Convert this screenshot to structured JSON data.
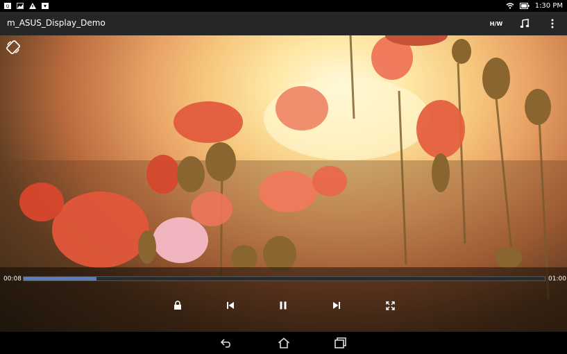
{
  "status_bar": {
    "time": "1:30 PM",
    "icons": [
      "notification-icon",
      "photo-icon",
      "warning-icon",
      "download-icon",
      "wifi-icon",
      "battery-icon"
    ]
  },
  "title_bar": {
    "title": "m_ASUS_Display_Demo",
    "hw_label": "H/W",
    "icons": [
      "music-note-icon",
      "overflow-menu-icon"
    ]
  },
  "player": {
    "elapsed": "00:08",
    "duration": "01:00",
    "progress_fraction": 0.14,
    "icons": [
      "lock-icon",
      "previous-icon",
      "pause-icon",
      "next-icon",
      "fullscreen-icon",
      "rotate-icon"
    ],
    "accent": "#5b7dbf"
  },
  "nav_bar": {
    "icons": [
      "back-icon",
      "home-icon",
      "recent-apps-icon"
    ]
  }
}
